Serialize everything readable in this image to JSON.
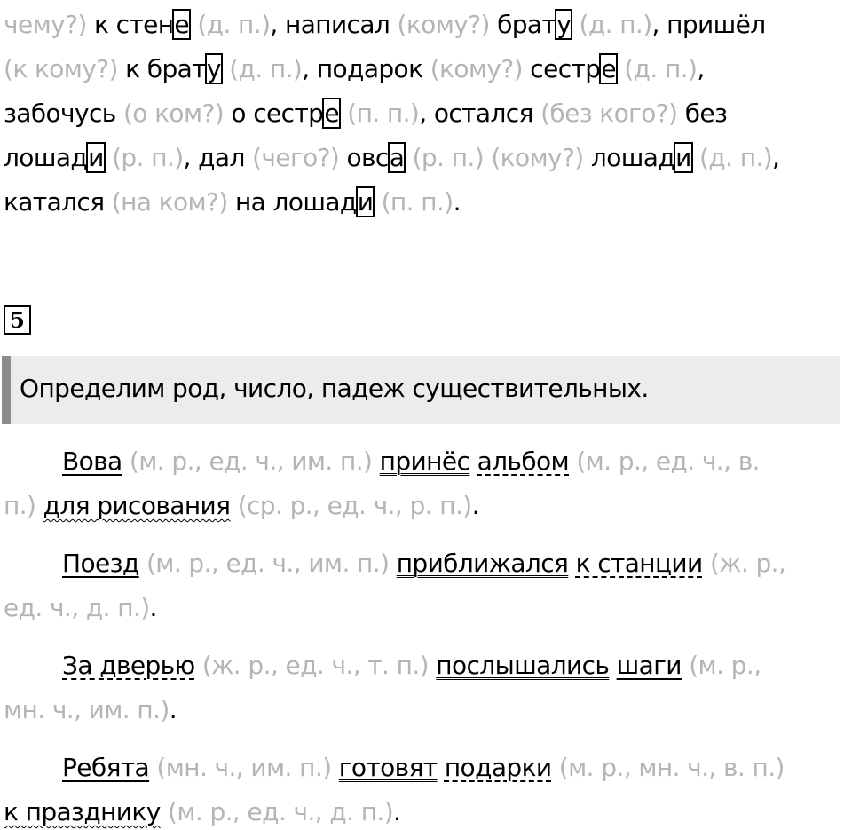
{
  "top": {
    "l1": {
      "a": "чему?)",
      "b": "к стен",
      "c": "е",
      "d": "(д. п.)",
      "e": ", написал",
      "f": "(кому?)",
      "g": "брат",
      "h": "у",
      "i": "(д. п.)",
      "j": ", пришёл"
    },
    "l2": {
      "a": "(к кому?)",
      "b": "к брат",
      "c": "у",
      "d": "(д. п.)",
      "e": ", подарок",
      "f": "(кому?)",
      "g": "сестр",
      "h": "е",
      "i": "(д. п.)",
      "j": ","
    },
    "l3": {
      "a": "забочусь",
      "b": "(о ком?)",
      "c": "о сестр",
      "d": "е",
      "e": "(п. п.)",
      "f": ", остался",
      "g": "(без кого?)",
      "h": "без"
    },
    "l4": {
      "a": "лошад",
      "b": "и",
      "c": "(р. п.)",
      "d": ", дал",
      "e": "(чего?)",
      "f": "овс",
      "g": "а",
      "h": "(р. п.)",
      "i": "(кому?)",
      "j": "лошад",
      "k": "и",
      "l": "(д. п.)",
      "m": ","
    },
    "l5": {
      "a": "катался",
      "b": "(на ком?)",
      "c": "на лошад",
      "d": "и",
      "e": "(п. п.)",
      "f": "."
    }
  },
  "task": {
    "number": "5",
    "banner": "Определим род, число, падеж существительных."
  },
  "s1": {
    "l1": {
      "a": "Вова",
      "b": "(м. р., ед. ч., им. п.)",
      "c": "принёс",
      "d": "альбом",
      "e": "(м. р., ед. ч., в."
    },
    "l2": {
      "a": "п.)",
      "b": "для рисования",
      "c": "(ср. р., ед. ч., р. п.)",
      "d": "."
    }
  },
  "s2": {
    "l1": {
      "a": "Поезд",
      "b": "(м. р., ед. ч., им. п.)",
      "c": "приближался",
      "d": "к станции",
      "e": "(ж. р.,"
    },
    "l2": {
      "a": "ед. ч., д. п.)",
      "b": "."
    }
  },
  "s3": {
    "l1": {
      "a": "За дверью",
      "b": "(ж. р., ед. ч., т. п.)",
      "c": "послышались",
      "d": "шаги",
      "e": "(м. р.,"
    },
    "l2": {
      "a": "мн. ч., им. п.)",
      "b": "."
    }
  },
  "s4": {
    "l1": {
      "a": "Ребята",
      "b": "(мн. ч., им. п.)",
      "c": "готовят",
      "d": "подарки",
      "e": "(м. р., мн. ч., в. п.)"
    },
    "l2": {
      "a": "к празднику",
      "b": "(м. р., ед. ч., д. п.)",
      "c": "."
    }
  }
}
